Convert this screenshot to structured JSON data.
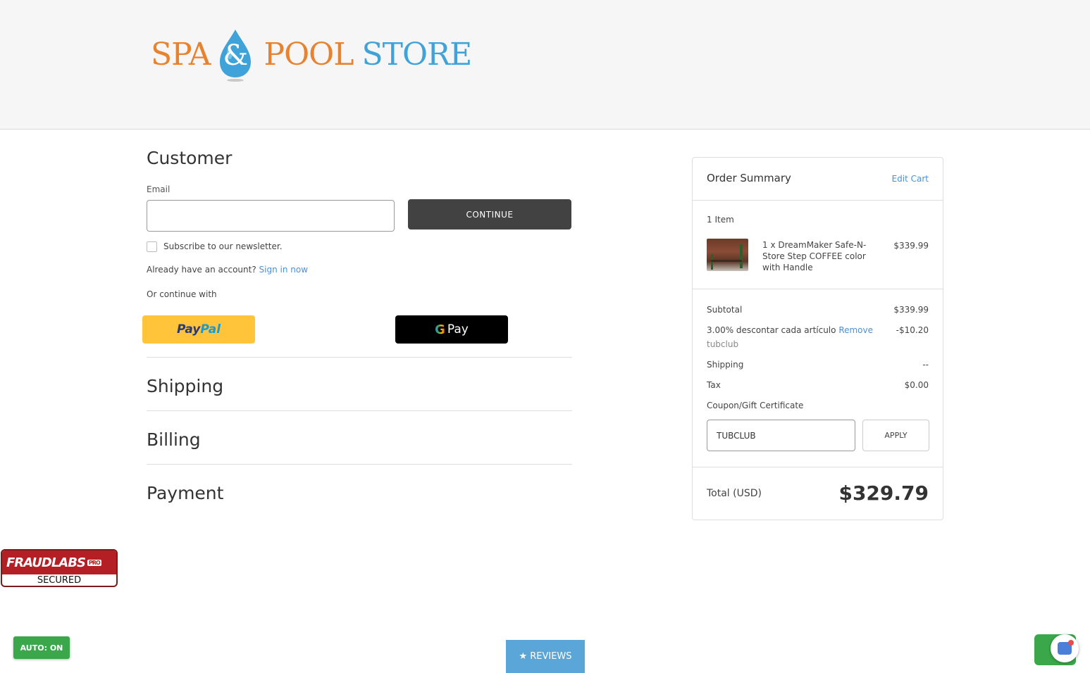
{
  "header": {
    "logo": {
      "part1": "SPA",
      "ampersand": "&",
      "part2": "POOL",
      "part3": "STORE"
    }
  },
  "customer": {
    "title": "Customer",
    "email_label": "Email",
    "email_value": "",
    "continue_label": "CONTINUE",
    "newsletter_label": "Subscribe to our newsletter.",
    "account_prompt": "Already have an account?",
    "sign_in_link": "Sign in now",
    "continue_with": "Or continue with",
    "paypal_pay": "Pay",
    "paypal_pal": "Pal",
    "gpay_g": "G",
    "gpay_label": "Pay"
  },
  "steps": {
    "shipping": "Shipping",
    "billing": "Billing",
    "payment": "Payment"
  },
  "summary": {
    "title": "Order Summary",
    "edit_cart": "Edit Cart",
    "item_count": "1 Item",
    "product_name": "1 x DreamMaker Safe-N-Store Step COFFEE color with Handle",
    "product_price": "$339.99",
    "subtotal_label": "Subtotal",
    "subtotal_value": "$339.99",
    "discount_label": "3.00% descontar cada artículo",
    "discount_remove": "Remove",
    "discount_code": "tubclub",
    "discount_value": "-$10.20",
    "shipping_label": "Shipping",
    "shipping_value": "--",
    "tax_label": "Tax",
    "tax_value": "$0.00",
    "coupon_link": "Coupon/Gift Certificate",
    "coupon_value": "TUBCLUB",
    "apply_label": "APPLY",
    "total_label": "Total (USD)",
    "total_value": "$329.79"
  },
  "badges": {
    "fraudlabs_title": "FRAUDLABS",
    "fraudlabs_pro": "PRO",
    "fraudlabs_secured": "SECURED",
    "auto_label": "AUTO: ON",
    "reviews_label": "★ REVIEWS"
  },
  "colors": {
    "logo_orange": "#e8822e",
    "logo_blue": "#3fa3d9",
    "link_blue": "#4a90d9",
    "continue_bg": "#424242",
    "paypal_yellow": "#ffc439"
  }
}
